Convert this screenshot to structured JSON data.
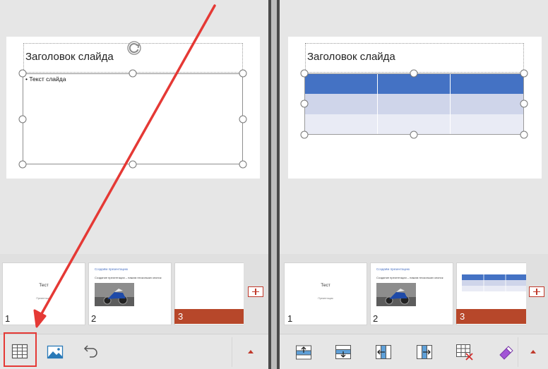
{
  "left_editor": {
    "slide_title": "Заголовок слайда",
    "bullet": "• Текст слайда"
  },
  "right_editor": {
    "slide_title": "Заголовок слайда",
    "table": {
      "rows": 3,
      "columns": 3,
      "row_colors": [
        "#4472c4",
        "#cfd5ea",
        "#e9ebf5"
      ]
    }
  },
  "thumbnails": [
    {
      "number": "1",
      "title": "Тест",
      "subtitle": "Презентация"
    },
    {
      "number": "2",
      "heading": "Создаём презентацию",
      "body": "Создание презентации – нажим нескольких кнопок"
    },
    {
      "number": "3",
      "selected": true
    }
  ],
  "add_slide_icon": "plus-square-icon",
  "left_toolbar": {
    "tools": [
      "insert-table-icon",
      "insert-picture-icon",
      "undo-icon"
    ],
    "expand_icon": "caret-up-icon"
  },
  "right_toolbar": {
    "tools": [
      "insert-row-above-icon",
      "insert-row-below-icon",
      "insert-column-left-icon",
      "insert-column-right-icon",
      "delete-table-icon",
      "eraser-icon"
    ],
    "expand_icon": "caret-up-icon"
  },
  "colors": {
    "accent": "#b7472a",
    "table_header": "#4472c4",
    "annotation": "#e53935"
  }
}
